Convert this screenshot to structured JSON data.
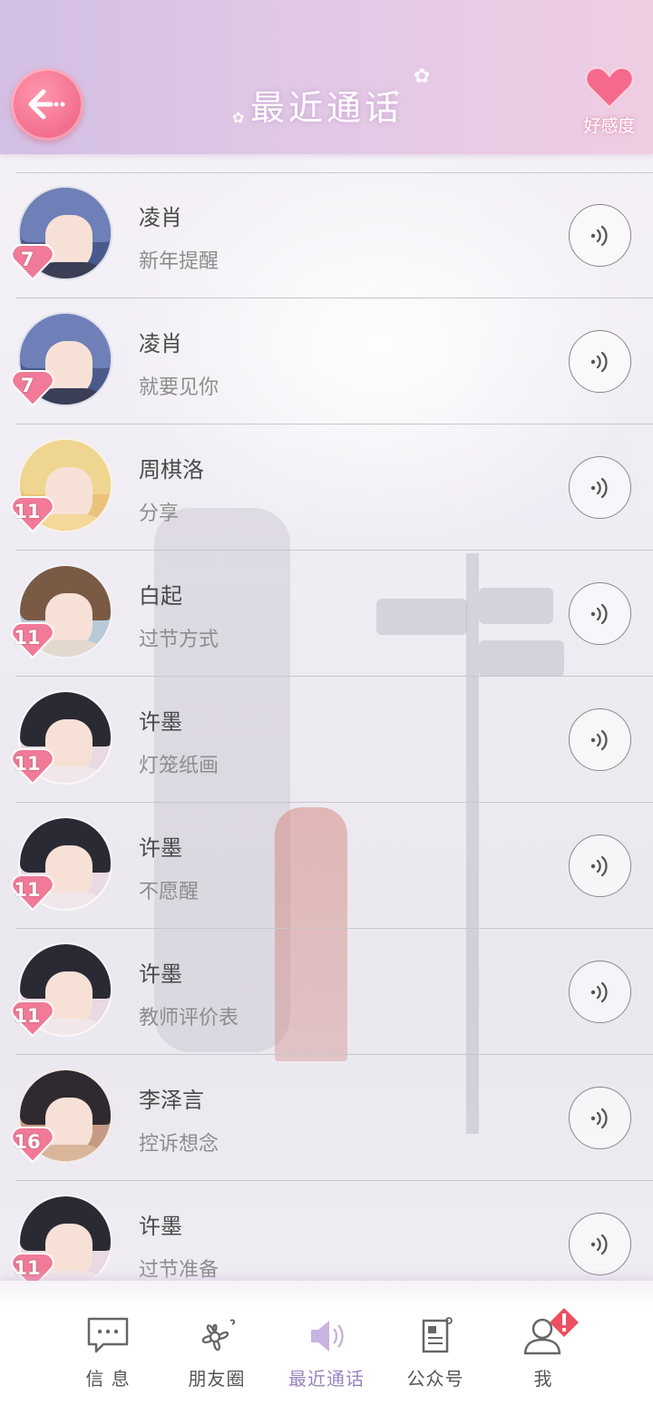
{
  "header": {
    "title": "最近通话",
    "favor_label": "好感度",
    "back_icon": "back-arrow-icon",
    "favor_icon": "heart-icon",
    "accent_color": "#ec5c7f"
  },
  "calls": [
    {
      "name": "凌肖",
      "subtitle": "新年提醒",
      "level": "7",
      "avatar_icon": "avatar-lingxiao"
    },
    {
      "name": "凌肖",
      "subtitle": "就要见你",
      "level": "7",
      "avatar_icon": "avatar-lingxiao"
    },
    {
      "name": "周棋洛",
      "subtitle": "分享",
      "level": "11",
      "avatar_icon": "avatar-zhouqiluo"
    },
    {
      "name": "白起",
      "subtitle": "过节方式",
      "level": "11",
      "avatar_icon": "avatar-baiqi"
    },
    {
      "name": "许墨",
      "subtitle": "灯笼纸画",
      "level": "11",
      "avatar_icon": "avatar-xumo"
    },
    {
      "name": "许墨",
      "subtitle": "不愿醒",
      "level": "11",
      "avatar_icon": "avatar-xumo"
    },
    {
      "name": "许墨",
      "subtitle": "教师评价表",
      "level": "11",
      "avatar_icon": "avatar-xumo"
    },
    {
      "name": "李泽言",
      "subtitle": "控诉想念",
      "level": "16",
      "avatar_icon": "avatar-lizeyan"
    },
    {
      "name": "许墨",
      "subtitle": "过节准备",
      "level": "11",
      "avatar_icon": "avatar-xumo"
    }
  ],
  "call_icon": "sound-wave-icon",
  "nav": {
    "messages": "信 息",
    "moments": "朋友圈",
    "recent_calls": "最近通话",
    "official_accounts": "公众号",
    "me": "我",
    "active": "recent_calls"
  }
}
